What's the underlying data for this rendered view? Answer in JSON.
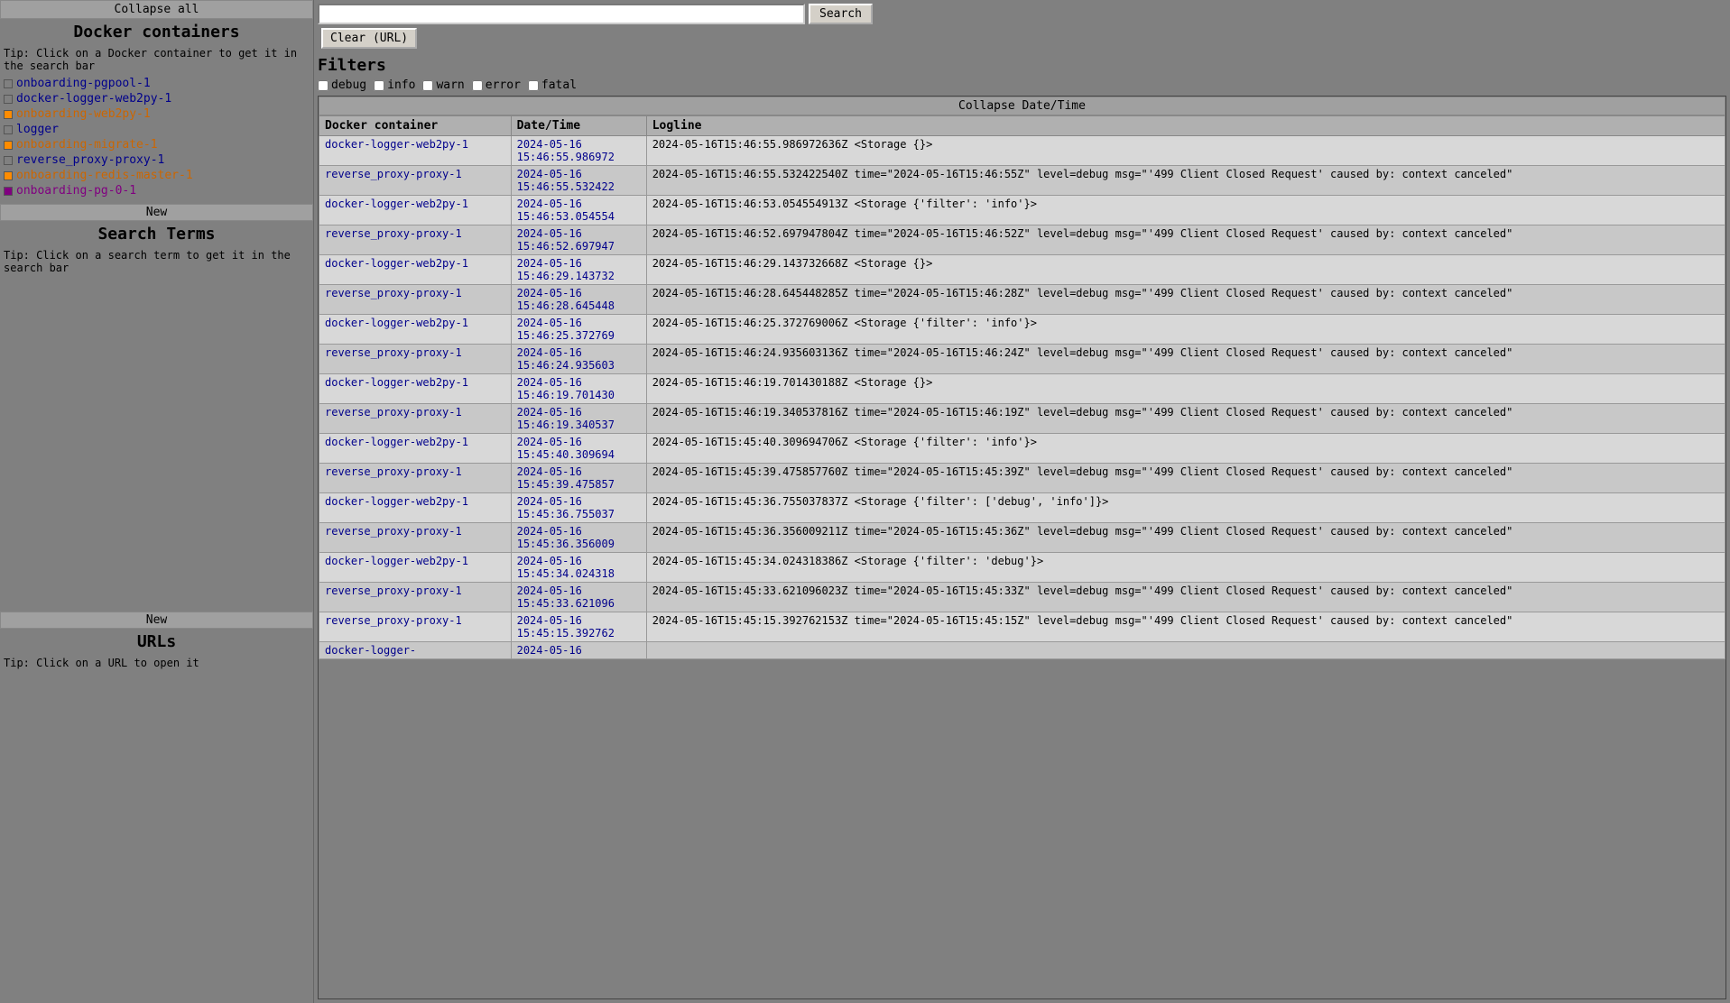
{
  "sidebar": {
    "collapse_label": "Collapse all",
    "docker_title": "Docker containers",
    "docker_tip": "Tip: Click on a Docker container to get it in the search bar",
    "containers": [
      {
        "name": "onboarding-pgpool-1",
        "color": "gray",
        "link_class": ""
      },
      {
        "name": "docker-logger-web2py-1",
        "color": "gray",
        "link_class": ""
      },
      {
        "name": "onboarding-web2py-1",
        "color": "orange",
        "link_class": "orange"
      },
      {
        "name": "logger",
        "color": "gray",
        "link_class": ""
      },
      {
        "name": "onboarding-migrate-1",
        "color": "orange",
        "link_class": "orange"
      },
      {
        "name": "reverse_proxy-proxy-1",
        "color": "gray",
        "link_class": ""
      },
      {
        "name": "onboarding-redis-master-1",
        "color": "orange",
        "link_class": "orange"
      },
      {
        "name": "onboarding-pg-0-1",
        "color": "purple",
        "link_class": "purple"
      }
    ],
    "search_terms_new": "New",
    "search_terms_title": "Search Terms",
    "search_terms_tip": "Tip: Click on a search term to get it in the search bar",
    "urls_new": "New",
    "urls_title": "URLs",
    "urls_tip": "Tip: Click on a URL to open it"
  },
  "topbar": {
    "search_placeholder": "",
    "search_button_label": "Search",
    "clear_button_label": "Clear (URL)"
  },
  "filters": {
    "title": "Filters",
    "items": [
      {
        "label": "debug",
        "checked": false
      },
      {
        "label": "info",
        "checked": false
      },
      {
        "label": "warn",
        "checked": false
      },
      {
        "label": "error",
        "checked": false
      },
      {
        "label": "fatal",
        "checked": false
      }
    ]
  },
  "log_table": {
    "collapse_datetime_label": "Collapse Date/Time",
    "headers": [
      "Docker container",
      "Date/Time",
      "Logline"
    ],
    "rows": [
      {
        "container": "docker-logger-web2py-1",
        "datetime": "2024-05-16\n15:46:55.986972",
        "logline": "2024-05-16T15:46:55.986972636Z <Storage {}>"
      },
      {
        "container": "reverse_proxy-proxy-1",
        "datetime": "2024-05-16\n15:46:55.532422",
        "logline": "2024-05-16T15:46:55.532422540Z time=\"2024-05-16T15:46:55Z\" level=debug msg=\"'499 Client Closed Request' caused by: context canceled\""
      },
      {
        "container": "docker-logger-web2py-1",
        "datetime": "2024-05-16\n15:46:53.054554",
        "logline": "2024-05-16T15:46:53.054554913Z <Storage {'filter': 'info'}>"
      },
      {
        "container": "reverse_proxy-proxy-1",
        "datetime": "2024-05-16\n15:46:52.697947",
        "logline": "2024-05-16T15:46:52.697947804Z time=\"2024-05-16T15:46:52Z\" level=debug msg=\"'499 Client Closed Request' caused by: context canceled\""
      },
      {
        "container": "docker-logger-web2py-1",
        "datetime": "2024-05-16\n15:46:29.143732",
        "logline": "2024-05-16T15:46:29.143732668Z <Storage {}>"
      },
      {
        "container": "reverse_proxy-proxy-1",
        "datetime": "2024-05-16\n15:46:28.645448",
        "logline": "2024-05-16T15:46:28.645448285Z time=\"2024-05-16T15:46:28Z\" level=debug msg=\"'499 Client Closed Request' caused by: context canceled\""
      },
      {
        "container": "docker-logger-web2py-1",
        "datetime": "2024-05-16\n15:46:25.372769",
        "logline": "2024-05-16T15:46:25.372769006Z <Storage {'filter': 'info'}>"
      },
      {
        "container": "reverse_proxy-proxy-1",
        "datetime": "2024-05-16\n15:46:24.935603",
        "logline": "2024-05-16T15:46:24.935603136Z time=\"2024-05-16T15:46:24Z\" level=debug msg=\"'499 Client Closed Request' caused by: context canceled\""
      },
      {
        "container": "docker-logger-web2py-1",
        "datetime": "2024-05-16\n15:46:19.701430",
        "logline": "2024-05-16T15:46:19.701430188Z <Storage {}>"
      },
      {
        "container": "reverse_proxy-proxy-1",
        "datetime": "2024-05-16\n15:46:19.340537",
        "logline": "2024-05-16T15:46:19.340537816Z time=\"2024-05-16T15:46:19Z\" level=debug msg=\"'499 Client Closed Request' caused by: context canceled\""
      },
      {
        "container": "docker-logger-web2py-1",
        "datetime": "2024-05-16\n15:45:40.309694",
        "logline": "2024-05-16T15:45:40.309694706Z <Storage {'filter': 'info'}>"
      },
      {
        "container": "reverse_proxy-proxy-1",
        "datetime": "2024-05-16\n15:45:39.475857",
        "logline": "2024-05-16T15:45:39.475857760Z time=\"2024-05-16T15:45:39Z\" level=debug msg=\"'499 Client Closed Request' caused by: context canceled\""
      },
      {
        "container": "docker-logger-web2py-1",
        "datetime": "2024-05-16\n15:45:36.755037",
        "logline": "2024-05-16T15:45:36.755037837Z <Storage {'filter': ['debug', 'info']}>"
      },
      {
        "container": "reverse_proxy-proxy-1",
        "datetime": "2024-05-16\n15:45:36.356009",
        "logline": "2024-05-16T15:45:36.356009211Z time=\"2024-05-16T15:45:36Z\" level=debug msg=\"'499 Client Closed Request' caused by: context canceled\""
      },
      {
        "container": "docker-logger-web2py-1",
        "datetime": "2024-05-16\n15:45:34.024318",
        "logline": "2024-05-16T15:45:34.024318386Z <Storage {'filter': 'debug'}>"
      },
      {
        "container": "reverse_proxy-proxy-1",
        "datetime": "2024-05-16\n15:45:33.621096",
        "logline": "2024-05-16T15:45:33.621096023Z time=\"2024-05-16T15:45:33Z\" level=debug msg=\"'499 Client Closed Request' caused by: context canceled\""
      },
      {
        "container": "reverse_proxy-proxy-1",
        "datetime": "2024-05-16\n15:45:15.392762",
        "logline": "2024-05-16T15:45:15.392762153Z time=\"2024-05-16T15:45:15Z\" level=debug msg=\"'499 Client Closed Request' caused by: context canceled\""
      },
      {
        "container": "docker-logger-",
        "datetime": "2024-05-16\n",
        "logline": ""
      }
    ]
  }
}
